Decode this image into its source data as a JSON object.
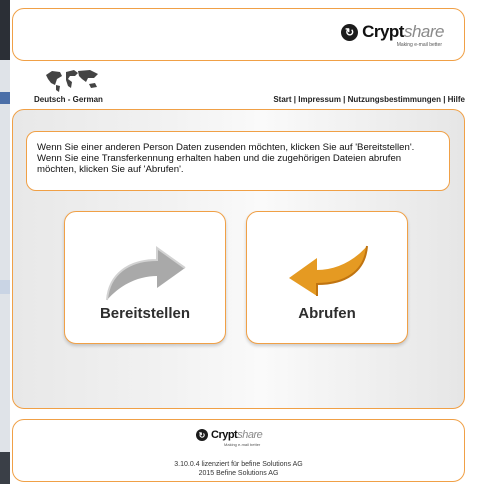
{
  "header": {
    "logo": {
      "brand": "Crypt",
      "brand_suffix": "share",
      "tagline": "Making e-mail better"
    }
  },
  "topbar": {
    "language": "Deutsch - German",
    "links": [
      "Start",
      "Impressum",
      "Nutzungsbestimmungen",
      "Hilfe"
    ],
    "separator": " | "
  },
  "info": {
    "text": "Wenn Sie einer anderen Person Daten zusenden möchten, klicken Sie auf 'Bereitstellen'. Wenn Sie eine Transferkennung erhalten haben und die zugehörigen Dateien abrufen möchten, klicken Sie auf 'Abrufen'."
  },
  "actions": {
    "provide": {
      "label": "Bereitstellen",
      "icon": "gray-curved-arrow-icon",
      "color": "#a9a9a9"
    },
    "retrieve": {
      "label": "Abrufen",
      "icon": "orange-curved-arrow-icon",
      "color": "#e59a22"
    }
  },
  "footer": {
    "logo": {
      "brand": "Crypt",
      "brand_suffix": "share",
      "tagline": "Making e-mail better"
    },
    "version_line": "3.10.0.4 lizenziert für befine Solutions AG",
    "copyright_line": "2015 Befine Solutions AG"
  },
  "colors": {
    "accent_border": "#f0a046",
    "panel_bg": "#eeeeee"
  }
}
